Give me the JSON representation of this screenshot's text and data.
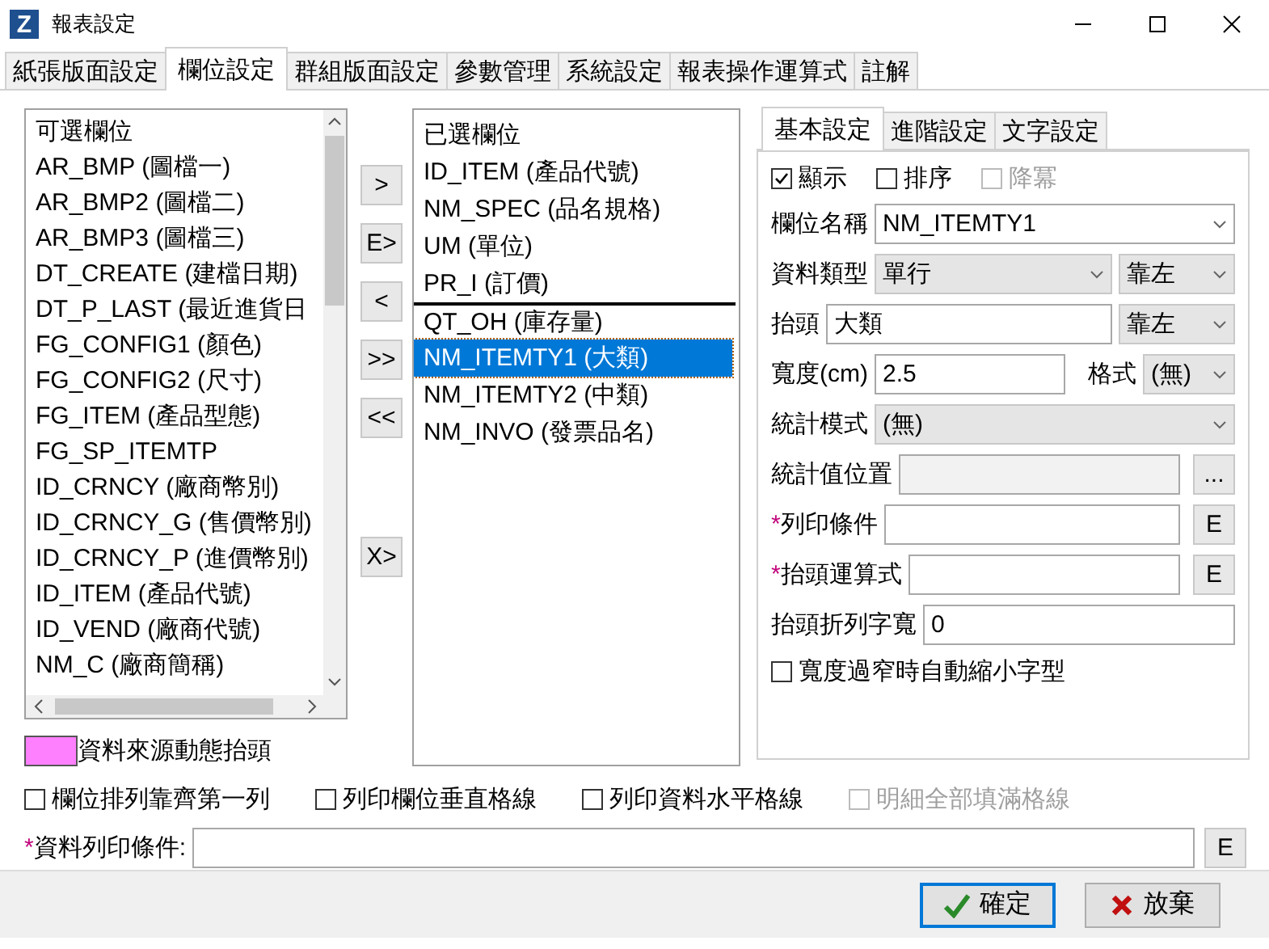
{
  "window": {
    "app_icon": "Z",
    "title": "報表設定"
  },
  "tabs": [
    {
      "label": "紙張版面設定",
      "selected": false
    },
    {
      "label": "欄位設定",
      "selected": true
    },
    {
      "label": "群組版面設定",
      "selected": false
    },
    {
      "label": "參數管理",
      "selected": false
    },
    {
      "label": "系統設定",
      "selected": false
    },
    {
      "label": "報表操作運算式",
      "selected": false
    },
    {
      "label": "註解",
      "selected": false
    }
  ],
  "available_fields": {
    "header": "可選欄位",
    "items": [
      {
        "label": "AR_BMP (圖檔一)",
        "selected": false
      },
      {
        "label": "AR_BMP2 (圖檔二)",
        "selected": false
      },
      {
        "label": "AR_BMP3 (圖檔三)",
        "selected": false
      },
      {
        "label": "DT_CREATE (建檔日期)",
        "selected": false
      },
      {
        "label": "DT_P_LAST (最近進貨日",
        "selected": false
      },
      {
        "label": "FG_CONFIG1 (顏色)",
        "selected": false
      },
      {
        "label": "FG_CONFIG2 (尺寸)",
        "selected": false
      },
      {
        "label": "FG_ITEM (產品型態)",
        "selected": false
      },
      {
        "label": "FG_SP_ITEMTP",
        "selected": false
      },
      {
        "label": "ID_CRNCY (廠商幣別)",
        "selected": false
      },
      {
        "label": "ID_CRNCY_G (售價幣別)",
        "selected": false
      },
      {
        "label": "ID_CRNCY_P (進價幣別)",
        "selected": false
      },
      {
        "label": "ID_ITEM (產品代號)",
        "selected": false
      },
      {
        "label": "ID_VEND (廠商代號)",
        "selected": false
      },
      {
        "label": "NM_C (廠商簡稱)",
        "selected": false
      }
    ]
  },
  "legend": {
    "color": "#ff80ff",
    "label": "資料來源動態抬頭"
  },
  "move_buttons": [
    ">",
    "E>",
    "<",
    ">>",
    "<<",
    "X>"
  ],
  "selected_fields": {
    "header": "已選欄位",
    "items": [
      {
        "label": "ID_ITEM (產品代號)",
        "selected": false,
        "insert_above": false
      },
      {
        "label": "NM_SPEC (品名規格)",
        "selected": false,
        "insert_above": false
      },
      {
        "label": "UM (單位)",
        "selected": false,
        "insert_above": false
      },
      {
        "label": "PR_I (訂價)",
        "selected": false,
        "insert_above": false
      },
      {
        "label": "QT_OH (庫存量)",
        "selected": false,
        "insert_above": true
      },
      {
        "label": "NM_ITEMTY1 (大類)",
        "selected": true,
        "insert_above": false
      },
      {
        "label": "NM_ITEMTY2 (中類)",
        "selected": false,
        "insert_above": false
      },
      {
        "label": "NM_INVO (發票品名)",
        "selected": false,
        "insert_above": false
      }
    ]
  },
  "detail_tabs": [
    {
      "label": "基本設定",
      "selected": true
    },
    {
      "label": "進階設定",
      "selected": false
    },
    {
      "label": "文字設定",
      "selected": false
    }
  ],
  "detail_checks": [
    {
      "label": "顯示",
      "checked": true,
      "disabled": false
    },
    {
      "label": "排序",
      "checked": false,
      "disabled": false
    },
    {
      "label": "降冪",
      "checked": false,
      "disabled": true
    }
  ],
  "detail_rows": [
    {
      "marker": "",
      "label": "欄位名稱",
      "controls": [
        {
          "kind": "combo",
          "value": "NM_ITEMTY1"
        }
      ]
    },
    {
      "marker": "",
      "label": "資料類型",
      "controls": [
        {
          "kind": "list",
          "value": "單行"
        },
        {
          "kind": "list",
          "value": "靠左"
        }
      ]
    },
    {
      "marker": "",
      "label": "抬頭",
      "controls": [
        {
          "kind": "text",
          "value": "大類"
        },
        {
          "kind": "list",
          "value": "靠左"
        }
      ]
    },
    {
      "marker": "",
      "label": "寬度(cm)",
      "controls": [
        {
          "kind": "text",
          "value": "2.5"
        },
        {
          "kind": "label",
          "value": "格式"
        },
        {
          "kind": "list",
          "value": "(無)"
        }
      ]
    },
    {
      "marker": "",
      "label": "統計模式",
      "controls": [
        {
          "kind": "list",
          "value": "(無)"
        }
      ]
    },
    {
      "marker": "",
      "label": "統計值位置",
      "controls": [
        {
          "kind": "readonly"
        },
        {
          "kind": "button",
          "value": "..."
        }
      ]
    },
    {
      "marker": "*",
      "label": "列印條件",
      "controls": [
        {
          "kind": "text"
        },
        {
          "kind": "button",
          "value": "E"
        }
      ]
    },
    {
      "marker": "*",
      "label": "抬頭運算式",
      "controls": [
        {
          "kind": "text"
        },
        {
          "kind": "button",
          "value": "E"
        }
      ]
    },
    {
      "marker": "",
      "label": "抬頭折列字寬",
      "controls": [
        {
          "kind": "text",
          "value": "0"
        }
      ]
    }
  ],
  "shrink_check": {
    "label": "寬度過窄時自動縮小字型",
    "checked": false,
    "disabled": false
  },
  "options": [
    {
      "label": "欄位排列靠齊第一列",
      "checked": false,
      "disabled": false
    },
    {
      "label": "列印欄位垂直格線",
      "checked": false,
      "disabled": false
    },
    {
      "label": "列印資料水平格線",
      "checked": false,
      "disabled": false
    },
    {
      "label": "明細全部填滿格線",
      "checked": false,
      "disabled": true
    }
  ],
  "print_condition": {
    "marker": "*",
    "label": "資料列印條件:",
    "button": "E"
  },
  "buttons": [
    {
      "kind": "ok",
      "label": "確定"
    },
    {
      "kind": "cancel",
      "label": "放棄"
    }
  ]
}
